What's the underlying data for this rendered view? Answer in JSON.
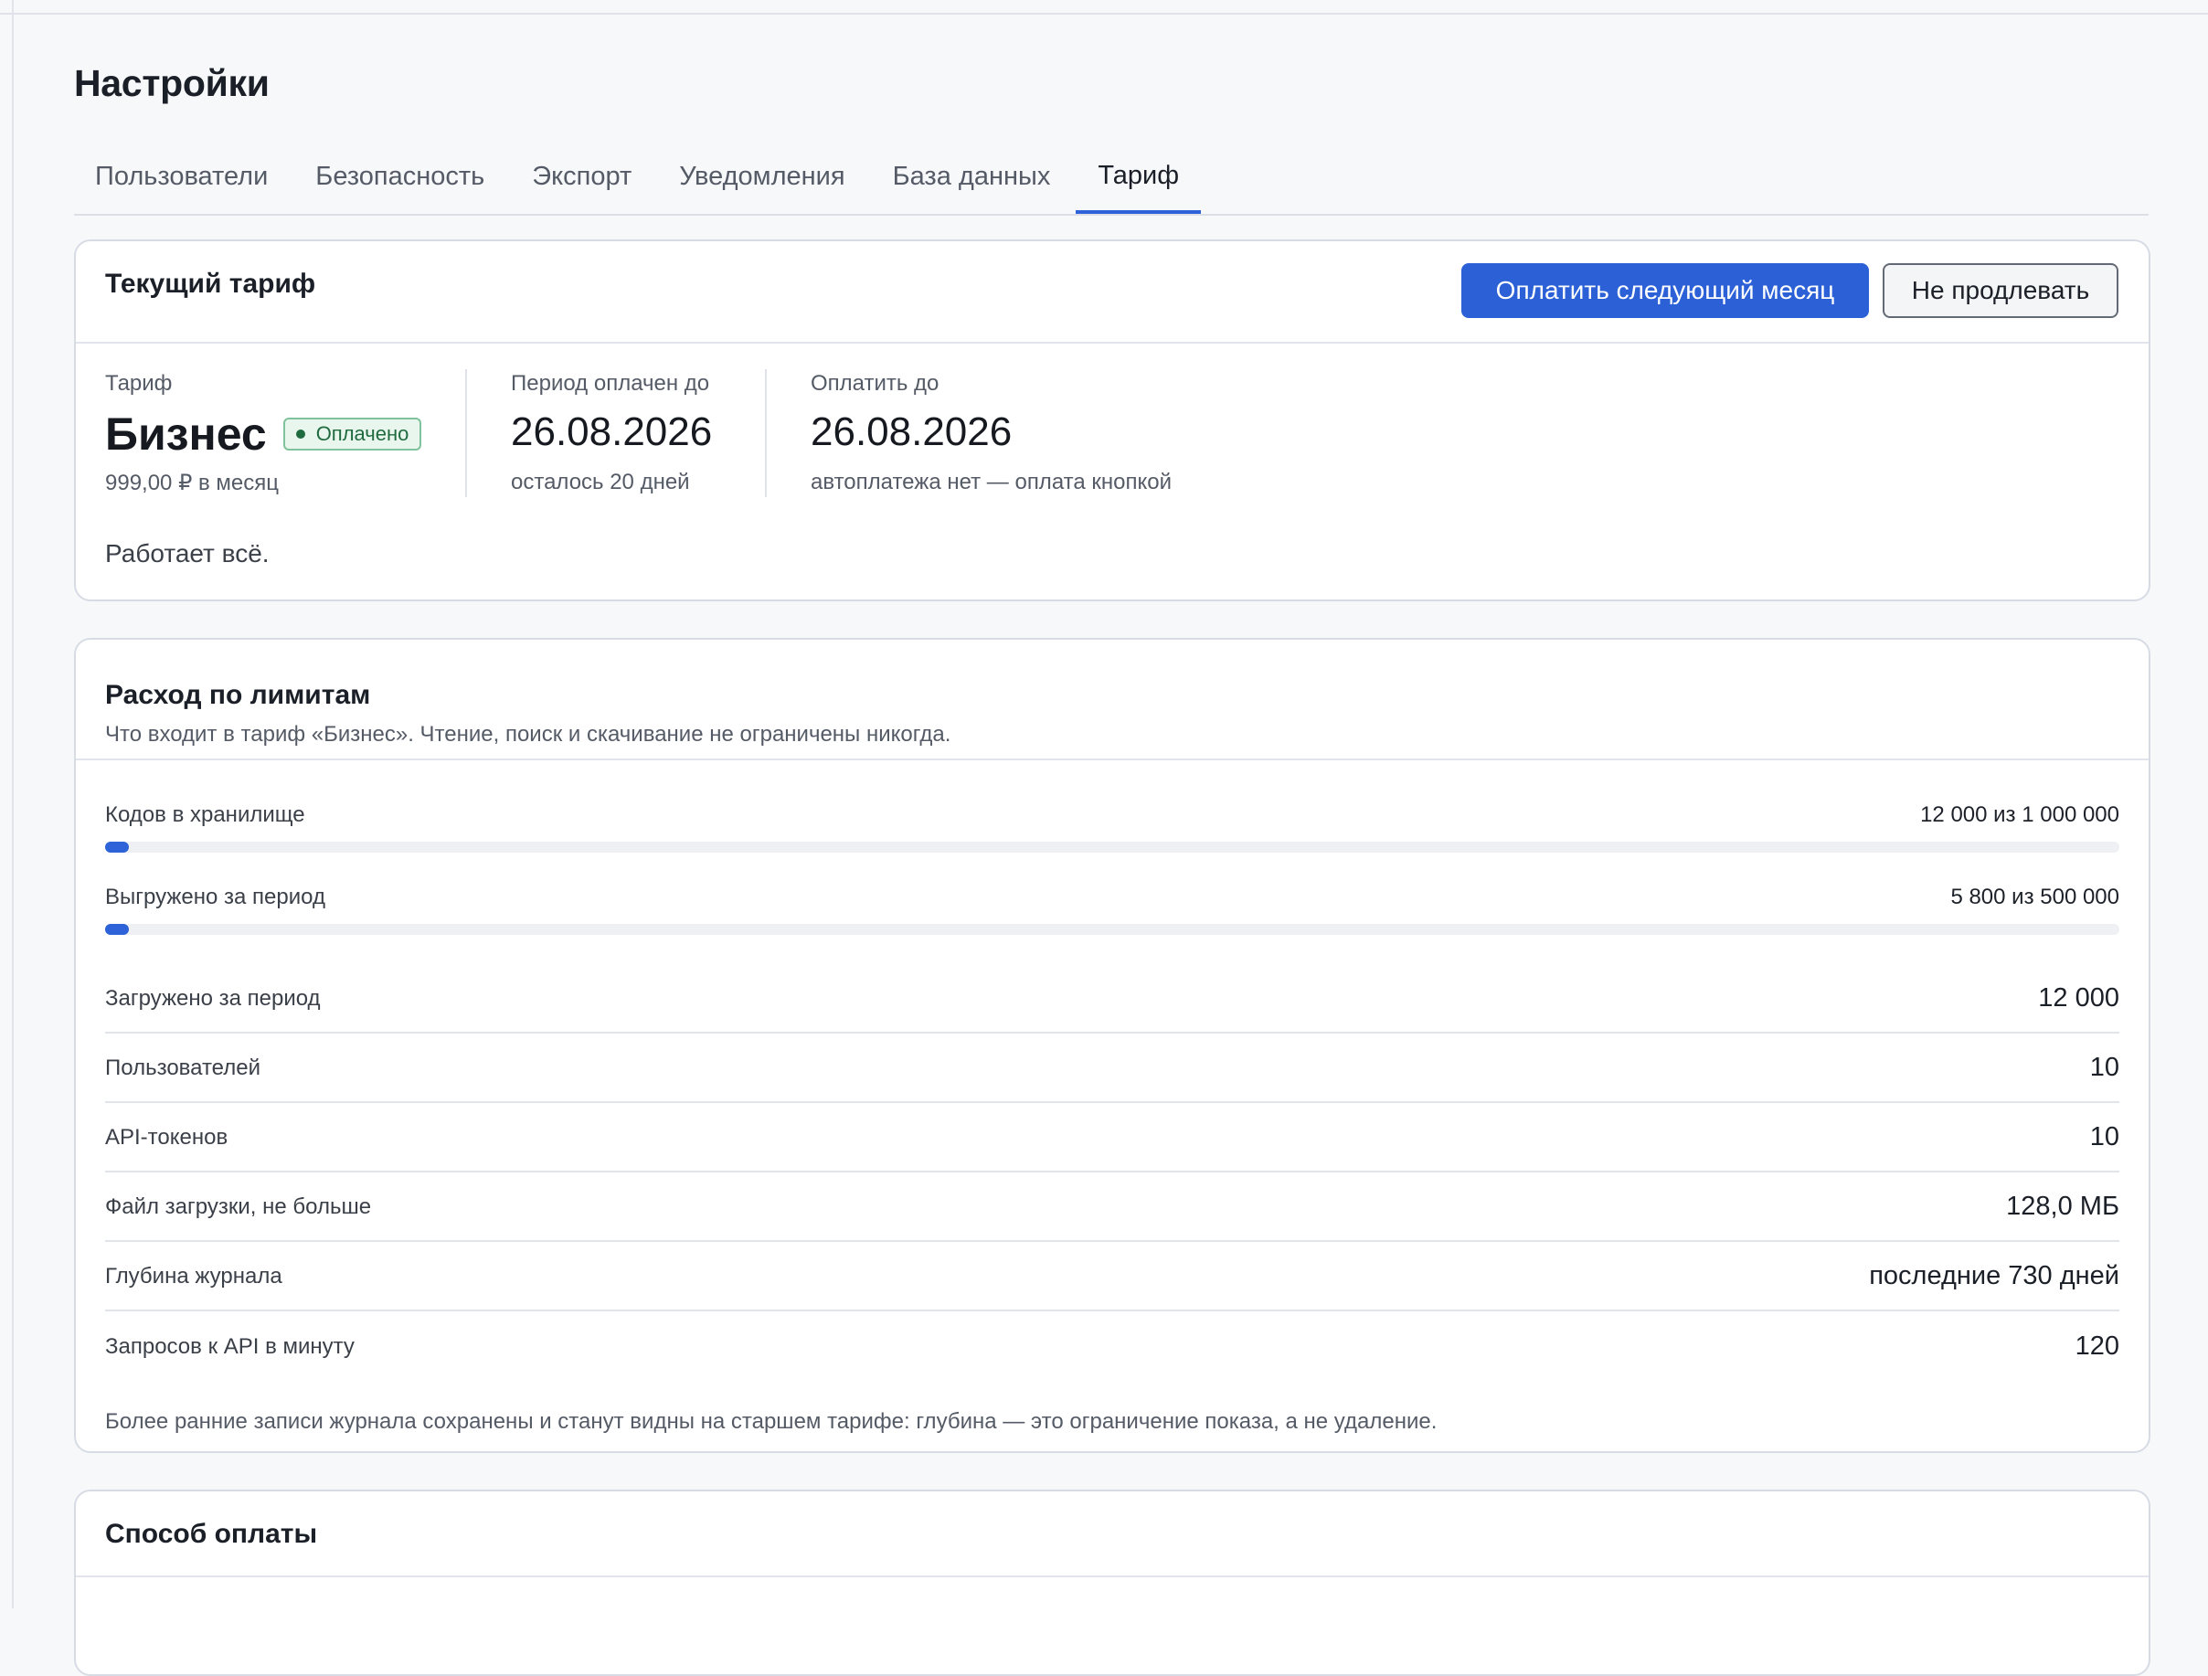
{
  "page_title": "Настройки",
  "tabs": [
    {
      "label": "Пользователи"
    },
    {
      "label": "Безопасность"
    },
    {
      "label": "Экспорт"
    },
    {
      "label": "Уведомления"
    },
    {
      "label": "База данных"
    },
    {
      "label": "Тариф",
      "active": true
    }
  ],
  "current_plan": {
    "title": "Текущий тариф",
    "pay_button": "Оплатить следующий месяц",
    "cancel_button": "Не продлевать",
    "plan_label": "Тариф",
    "plan_name": "Бизнес",
    "status_badge": "Оплачено",
    "price": "999,00 ₽ в месяц",
    "paid_until_label": "Период оплачен до",
    "paid_until_date": "26.08.2026",
    "days_left": "осталось 20 дней",
    "pay_by_label": "Оплатить до",
    "pay_by_date": "26.08.2026",
    "autopay_note": "автоплатежа нет — оплата кнопкой",
    "status_text": "Работает всё."
  },
  "limits": {
    "title": "Расход по лимитам",
    "subtitle": "Что входит в тариф «Бизнес». Чтение, поиск и скачивание не ограничены никогда.",
    "meters": [
      {
        "label": "Кодов в хранилище",
        "value_text": "12 000 из 1 000 000",
        "used": 12000,
        "total": 1000000
      },
      {
        "label": "Выгружено за период",
        "value_text": "5 800 из 500 000",
        "used": 5800,
        "total": 500000
      }
    ],
    "rows": [
      {
        "label": "Загружено за период",
        "value": "12 000"
      },
      {
        "label": "Пользователей",
        "value": "10"
      },
      {
        "label": "API-токенов",
        "value": "10"
      },
      {
        "label": "Файл загрузки, не больше",
        "value": "128,0 МБ"
      },
      {
        "label": "Глубина журнала",
        "value": "последние 730 дней"
      },
      {
        "label": "Запросов к API в минуту",
        "value": "120"
      }
    ],
    "footnote": "Более ранние записи журнала сохранены и станут видны на старшем тарифе: глубина — это ограничение показа, а не удаление."
  },
  "payment_method": {
    "title": "Способ оплаты"
  },
  "colors": {
    "accent": "#2d62d8",
    "success": "#1f6b3f",
    "success_bg": "#e9f6ee"
  }
}
